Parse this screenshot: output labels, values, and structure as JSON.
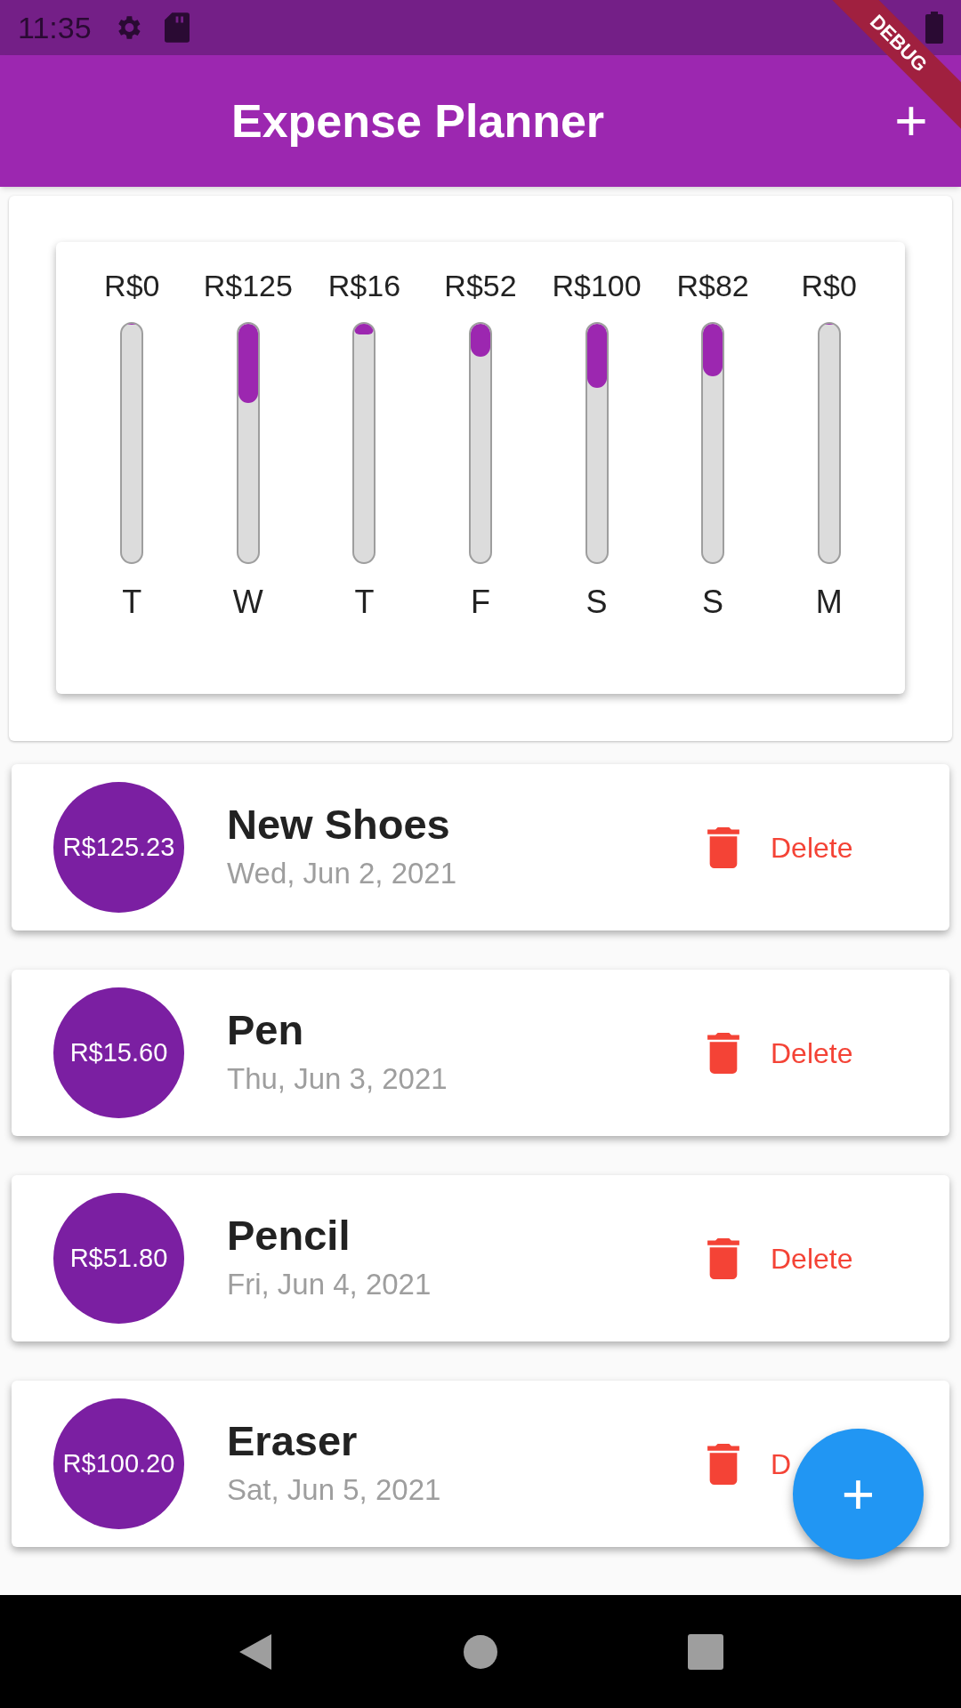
{
  "status_bar": {
    "time": "11:35"
  },
  "debug_banner": "DEBUG",
  "app_bar": {
    "title": "Expense Planner",
    "add_button": "+"
  },
  "chart": {
    "bars": [
      {
        "amount": "R$0",
        "day": "T",
        "level": 0
      },
      {
        "amount": "R$125",
        "day": "W",
        "level": 0.333
      },
      {
        "amount": "R$16",
        "day": "T",
        "level": 0.043
      },
      {
        "amount": "R$52",
        "day": "F",
        "level": 0.139
      },
      {
        "amount": "R$100",
        "day": "S",
        "level": 0.267
      },
      {
        "amount": "R$82",
        "day": "S",
        "level": 0.219
      },
      {
        "amount": "R$0",
        "day": "M",
        "level": 0
      }
    ]
  },
  "transactions": [
    {
      "amount": "R$125.23",
      "title": "New Shoes",
      "date": "Wed, Jun 2, 2021",
      "delete_label": "Delete"
    },
    {
      "amount": "R$15.60",
      "title": "Pen",
      "date": "Thu, Jun 3, 2021",
      "delete_label": "Delete"
    },
    {
      "amount": "R$51.80",
      "title": "Pencil",
      "date": "Fri, Jun 4, 2021",
      "delete_label": "Delete"
    },
    {
      "amount": "R$100.20",
      "title": "Eraser",
      "date": "Sat, Jun 5, 2021",
      "delete_label": "D"
    }
  ],
  "fab": "+"
}
